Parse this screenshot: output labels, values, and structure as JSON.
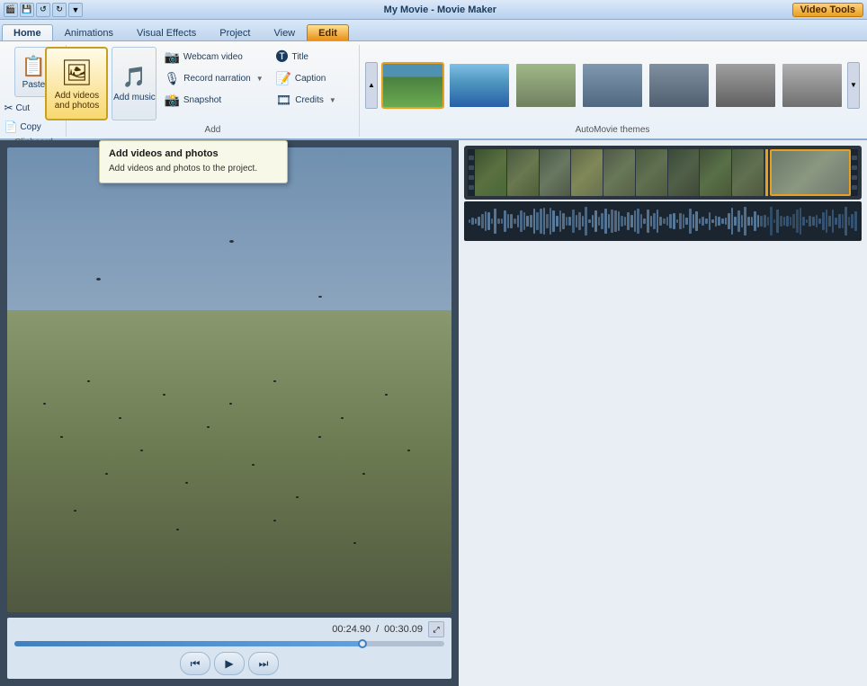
{
  "titlebar": {
    "title": "My Movie - Movie Maker",
    "video_tools_label": "Video Tools",
    "icons": [
      "◀",
      "▶",
      "↺",
      "▼"
    ]
  },
  "tabs": {
    "items": [
      "Home",
      "Animations",
      "Visual Effects",
      "Project",
      "View",
      "Edit"
    ],
    "active": "Home"
  },
  "clipboard": {
    "label": "Clipboard",
    "paste_label": "Paste",
    "cut_label": "Cut",
    "copy_label": "Copy"
  },
  "add_group": {
    "label": "Add",
    "add_videos_label": "Add videos and photos",
    "add_music_label": "Add music",
    "webcam_label": "Webcam video",
    "narration_label": "Record narration",
    "snapshot_label": "Snapshot"
  },
  "text_group": {
    "title_label": "Title",
    "caption_label": "Caption",
    "credits_label": "Credits"
  },
  "automovie": {
    "label": "AutoMovie themes",
    "themes": [
      {
        "id": "theme1",
        "color1": "#4a7a40",
        "color2": "#2a5a20"
      },
      {
        "id": "theme2",
        "color1": "#3060a0",
        "color2": "#204880"
      },
      {
        "id": "theme3",
        "color1": "#6a8050",
        "color2": "#4a6030"
      },
      {
        "id": "theme4",
        "color1": "#5a7090",
        "color2": "#3a5070"
      },
      {
        "id": "theme5",
        "color1": "#708090",
        "color2": "#506070"
      },
      {
        "id": "theme6",
        "color1": "#808080",
        "color2": "#606060"
      },
      {
        "id": "theme7",
        "color1": "#909090",
        "color2": "#707070"
      }
    ]
  },
  "tooltip": {
    "title": "Add videos and photos",
    "description": "Add videos and photos to the project."
  },
  "player": {
    "time_current": "00:24.90",
    "time_total": "00:30.09",
    "progress_percent": 81
  },
  "controls": {
    "rewind_label": "⏮",
    "play_label": "▶",
    "forward_label": "⏭"
  }
}
